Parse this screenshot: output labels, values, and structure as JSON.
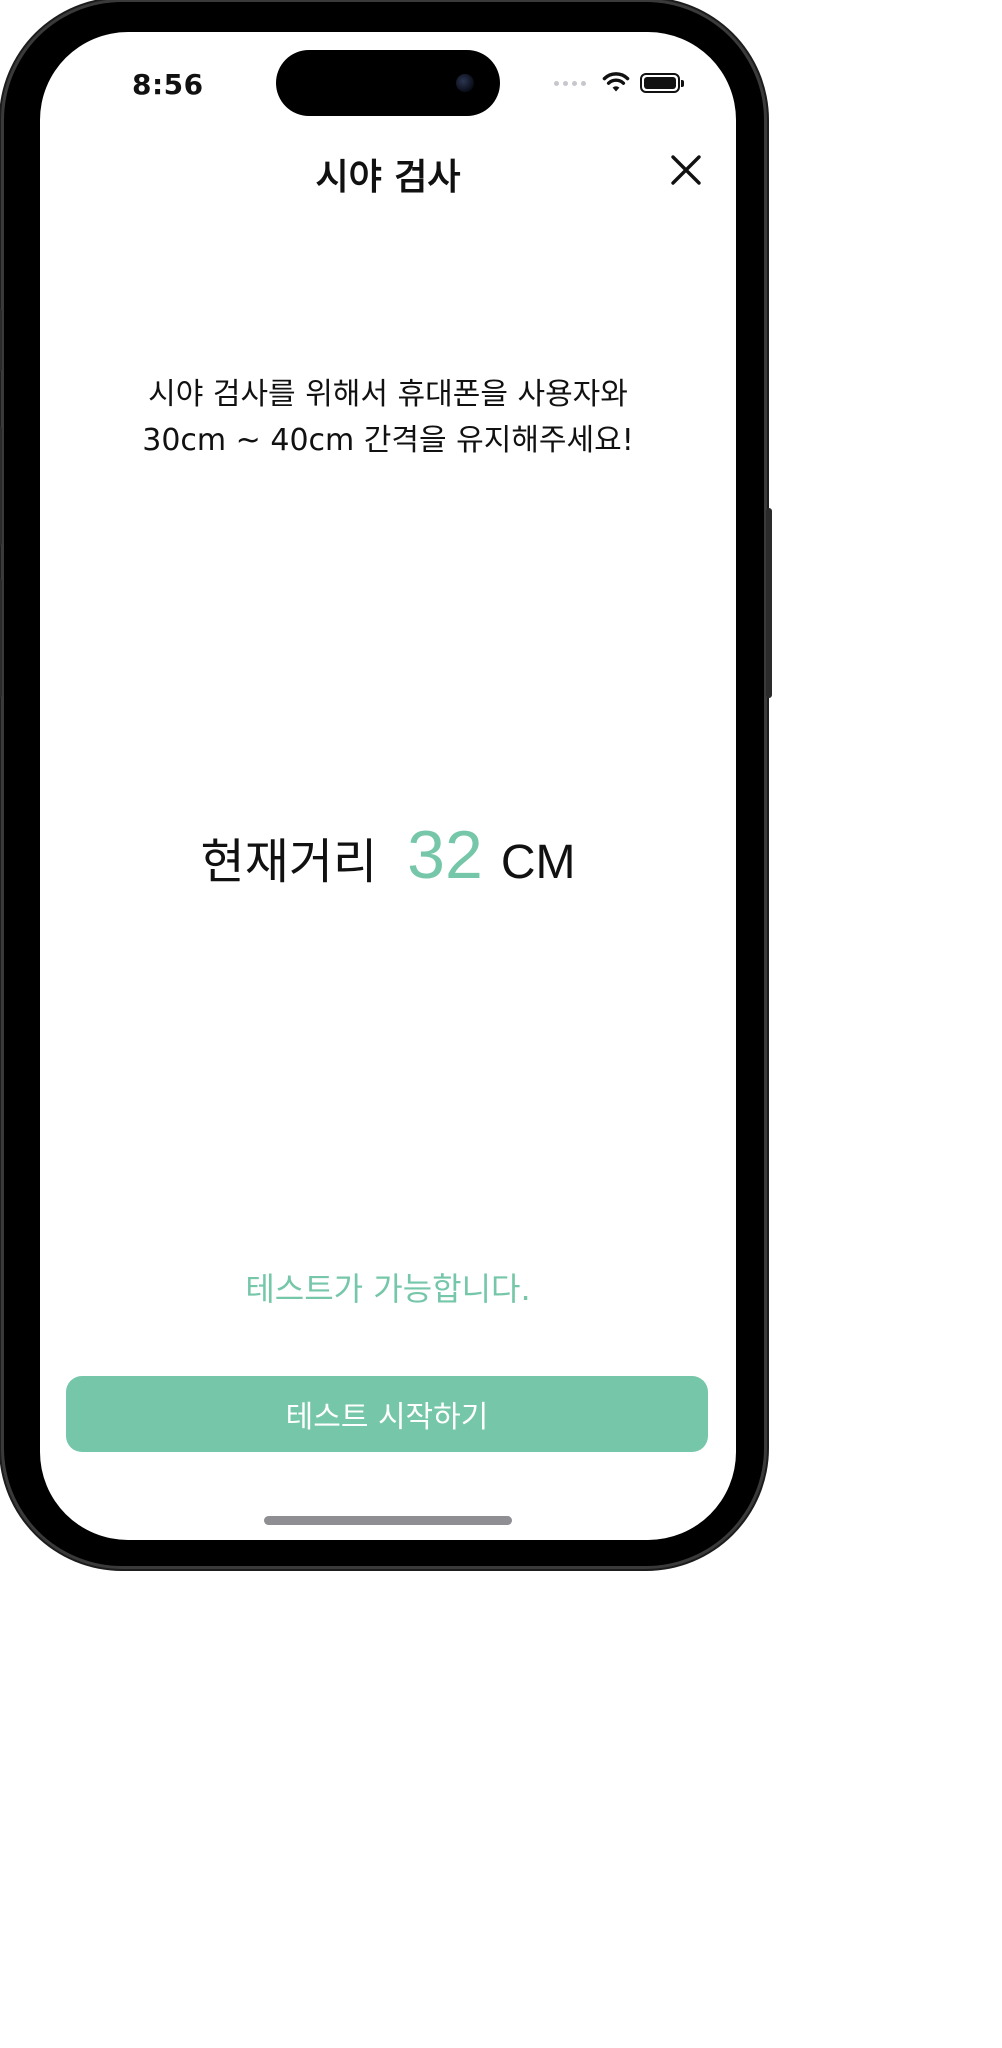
{
  "status_bar": {
    "time": "8:56",
    "icons": [
      "signal-dots-icon",
      "wifi-icon",
      "battery-icon"
    ]
  },
  "nav": {
    "title": "시야 검사",
    "close_icon": "close-icon"
  },
  "instruction": {
    "line1": "시야 검사를 위해서 휴대폰을 사용자와",
    "line2": "30cm ~ 40cm 간격을 유지해주세요!"
  },
  "distance": {
    "label": "현재거리",
    "value": "32",
    "unit": "CM"
  },
  "status_message": "테스트가 가능합니다.",
  "start_button": {
    "label": "테스트 시작하기"
  },
  "colors": {
    "accent": "#76c7a9",
    "text": "#111111",
    "background": "#ffffff"
  }
}
